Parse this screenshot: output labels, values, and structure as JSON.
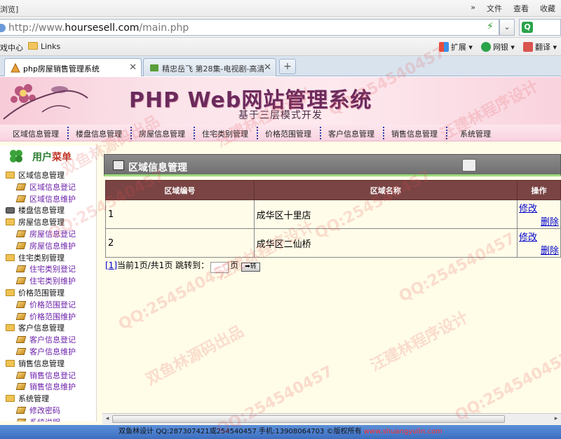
{
  "browser": {
    "menu_left": "浏览]",
    "menu_right": [
      "»",
      "文件",
      "查看",
      "收藏"
    ],
    "url_prefix": "http://www.",
    "url_domain": "hoursesell.com",
    "url_path": "/main.php",
    "favorites": [
      "戏中心",
      "Links"
    ],
    "tools": [
      "扩展",
      "网银",
      "翻译"
    ],
    "tabs": [
      {
        "title": "php房屋销售管理系统",
        "active": true
      },
      {
        "title": "精忠岳飞 第28集-电视剧-高清",
        "active": false
      }
    ],
    "new_tab": "+"
  },
  "banner": {
    "title": "PHP Web网站管理系统",
    "subtitle": "基于三层模式开发"
  },
  "topnav": [
    "区域信息管理",
    "楼盘信息管理",
    "房屋信息管理",
    "住宅类别管理",
    "价格范围管理",
    "客户信息管理",
    "销售信息管理",
    "系统管理"
  ],
  "sidebar": {
    "title_a": "用户",
    "title_b": "菜单",
    "tree": [
      {
        "label": "区域信息管理",
        "type": "cat"
      },
      {
        "label": "区域信息登记",
        "type": "sub"
      },
      {
        "label": "区域信息维护",
        "type": "sub"
      },
      {
        "label": "楼盘信息管理",
        "type": "cat2"
      },
      {
        "label": "房屋信息管理",
        "type": "cat"
      },
      {
        "label": "房屋信息登记",
        "type": "sub"
      },
      {
        "label": "房屋信息维护",
        "type": "sub"
      },
      {
        "label": "住宅类别管理",
        "type": "cat"
      },
      {
        "label": "住宅类别登记",
        "type": "sub"
      },
      {
        "label": "住宅类别维护",
        "type": "sub"
      },
      {
        "label": "价格范围管理",
        "type": "cat"
      },
      {
        "label": "价格范围登记",
        "type": "sub"
      },
      {
        "label": "价格范围维护",
        "type": "sub"
      },
      {
        "label": "客户信息管理",
        "type": "cat"
      },
      {
        "label": "客户信息登记",
        "type": "sub"
      },
      {
        "label": "客户信息维护",
        "type": "sub"
      },
      {
        "label": "销售信息管理",
        "type": "cat"
      },
      {
        "label": "销售信息登记",
        "type": "sub"
      },
      {
        "label": "销售信息维护",
        "type": "sub"
      },
      {
        "label": "系统管理",
        "type": "cat"
      },
      {
        "label": "修改密码",
        "type": "sub"
      },
      {
        "label": "系统说明",
        "type": "sub"
      }
    ]
  },
  "panel": {
    "title": "区域信息管理",
    "columns": [
      "区域编号",
      "区域名称",
      "操作"
    ],
    "rows": [
      {
        "id": "1",
        "name": "成华区十里店",
        "edit": "修改",
        "delete": "删除"
      },
      {
        "id": "2",
        "name": "成华区二仙桥",
        "edit": "修改",
        "delete": "删除"
      }
    ]
  },
  "pager": {
    "page_link": "[1]",
    "status": "当前1页/共1页 跳转到：",
    "page_unit": "页",
    "go": "➡转"
  },
  "footer": {
    "text": "双鱼林设计 QQ:287307421或254540457 手机:13908064703 ©版权所有 ",
    "link": "www.shuangyulin.com"
  },
  "watermarks": [
    "QQ:254540457",
    "汪建林程序设计",
    "双鱼林源码出品"
  ],
  "colors": {
    "table_header": "#7a4444",
    "link": "#0000cc",
    "footer_bg": "#3d6fc1",
    "page_bg": "#fffce8"
  }
}
